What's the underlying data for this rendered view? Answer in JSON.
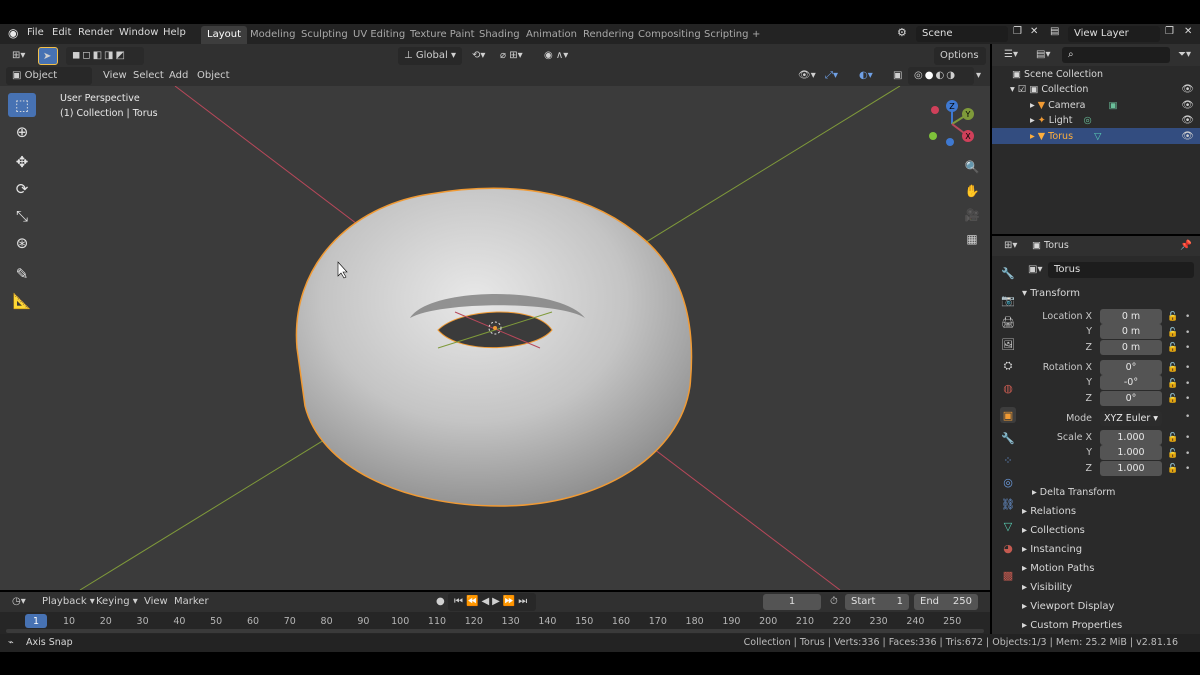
{
  "menu": {
    "items": [
      "File",
      "Edit",
      "Render",
      "Window",
      "Help"
    ]
  },
  "workspaces": {
    "tabs": [
      "Layout",
      "Modeling",
      "Sculpting",
      "UV Editing",
      "Texture Paint",
      "Shading",
      "Animation",
      "Rendering",
      "Compositing",
      "Scripting"
    ],
    "active": "Layout",
    "add": "+"
  },
  "scene": {
    "name": "Scene",
    "view_layer": "View Layer"
  },
  "viewport_header": {
    "mode": "Object Mode",
    "menus": [
      "View",
      "Select",
      "Add",
      "Object"
    ],
    "orientation": "Global",
    "options": "Options"
  },
  "viewport": {
    "perspective": "User Perspective",
    "collection_info": "(1) Collection | Torus",
    "gizmo": {
      "z": "Z",
      "y": "Y",
      "x": "X"
    }
  },
  "outliner": {
    "root": "Scene Collection",
    "collection": "Collection",
    "items": [
      "Camera",
      "Light",
      "Torus"
    ],
    "selected": "Torus"
  },
  "properties": {
    "object_name": "Torus",
    "datablock_name": "Torus",
    "transform_title": "Transform",
    "location": {
      "label": "Location X",
      "x": "0 m",
      "y": "0 m",
      "z": "0 m"
    },
    "rotation": {
      "label": "Rotation X",
      "x": "0°",
      "y": "-0°",
      "z": "0°"
    },
    "mode": {
      "label": "Mode",
      "value": "XYZ Euler"
    },
    "scale": {
      "label": "Scale X",
      "x": "1.000",
      "y": "1.000",
      "z": "1.000"
    },
    "axis_labels": {
      "y": "Y",
      "z": "Z"
    },
    "delta": "Delta Transform",
    "panels": [
      "Relations",
      "Collections",
      "Instancing",
      "Motion Paths",
      "Visibility",
      "Viewport Display",
      "Custom Properties"
    ]
  },
  "timeline": {
    "menus": [
      "Playback",
      "Keying",
      "View",
      "Marker"
    ],
    "current_frame": "1",
    "start_label": "Start",
    "start": "1",
    "end_label": "End",
    "end": "250",
    "ruler": [
      "1",
      "10",
      "20",
      "30",
      "40",
      "50",
      "60",
      "70",
      "80",
      "90",
      "100",
      "110",
      "120",
      "130",
      "140",
      "150",
      "160",
      "170",
      "180",
      "190",
      "200",
      "210",
      "220",
      "230",
      "240",
      "250"
    ]
  },
  "status": {
    "left": "Axis Snap",
    "right": "Collection | Torus | Verts:336 | Faces:336 | Tris:672 | Objects:1/3 | Mem: 25.2 MiB | v2.81.16"
  },
  "colors": {
    "accent": "#4772b3",
    "selection_outline": "#f09a34",
    "x_axis": "#b8485a",
    "y_axis": "#7f9a3a",
    "z_axis": "#3f79d1"
  }
}
